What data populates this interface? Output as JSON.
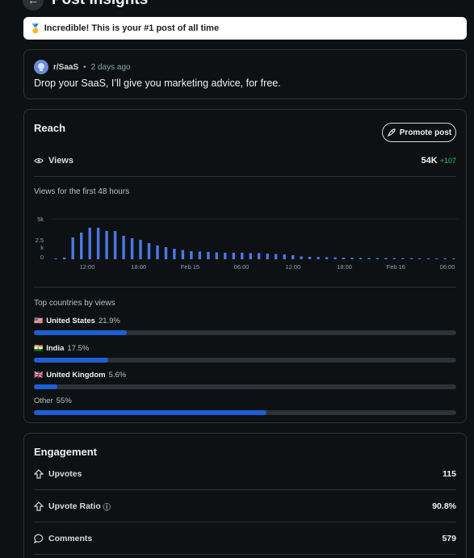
{
  "header": {
    "title": "Post Insights",
    "back_icon": "arrow-left-icon"
  },
  "banner": {
    "icon": "medal-icon",
    "text": "Incredible! This is your #1 post of all time"
  },
  "post": {
    "subreddit": "r/SaaS",
    "separator": "•",
    "time": "2 days ago",
    "title": "Drop your SaaS, I’ll give you marketing advice, for free."
  },
  "reach": {
    "title": "Reach",
    "promote_label": "Promote post",
    "views_label": "Views",
    "views_value": "54K",
    "views_delta": "+107",
    "chart_caption": "Views for the first 48 hours",
    "countries_title": "Top countries by views",
    "countries": [
      {
        "flag": "🇺🇸",
        "name": "United States",
        "pct": "21.9%",
        "fraction": 0.219
      },
      {
        "flag": "🇮🇳",
        "name": "India",
        "pct": "17.5%",
        "fraction": 0.175
      },
      {
        "flag": "🇬🇧",
        "name": "United Kingdom",
        "pct": "5.6%",
        "fraction": 0.056
      },
      {
        "flag": "",
        "name": "Other",
        "pct": "55%",
        "fraction": 0.55
      }
    ]
  },
  "engagement": {
    "title": "Engagement",
    "metrics": [
      {
        "label": "Upvotes",
        "value": "115",
        "icon": "upvote-icon",
        "info": false
      },
      {
        "label": "Upvote Ratio",
        "value": "90.8%",
        "icon": "upvote-icon",
        "info": true
      },
      {
        "label": "Comments",
        "value": "579",
        "icon": "comment-icon",
        "info": false
      }
    ]
  },
  "chart_data": {
    "type": "bar",
    "title": "Views for the first 48 hours",
    "xlabel": "",
    "ylabel": "",
    "y_ticks": [
      "5k",
      "2.5",
      "k",
      "0"
    ],
    "ylim": [
      0,
      5000
    ],
    "x_ticks": [
      "12:00",
      "18:00",
      "Feb 15",
      "06:00",
      "12:00",
      "18:00",
      "Feb 16",
      "06:00"
    ],
    "values": [
      30,
      220,
      2700,
      3300,
      3900,
      3900,
      3500,
      3500,
      2900,
      2600,
      2400,
      2000,
      1700,
      1500,
      1300,
      1150,
      1000,
      950,
      900,
      850,
      800,
      800,
      800,
      750,
      750,
      700,
      650,
      600,
      500,
      350,
      300,
      280,
      250,
      230,
      200,
      180,
      170,
      160,
      150,
      150,
      140,
      130,
      120,
      110,
      100,
      100,
      90,
      80
    ],
    "bar_color": "#4a78e6"
  },
  "colors": {
    "bar_fill": "#1e5fd6",
    "accent_green": "#3fbf5f",
    "background": "#0e1113"
  }
}
